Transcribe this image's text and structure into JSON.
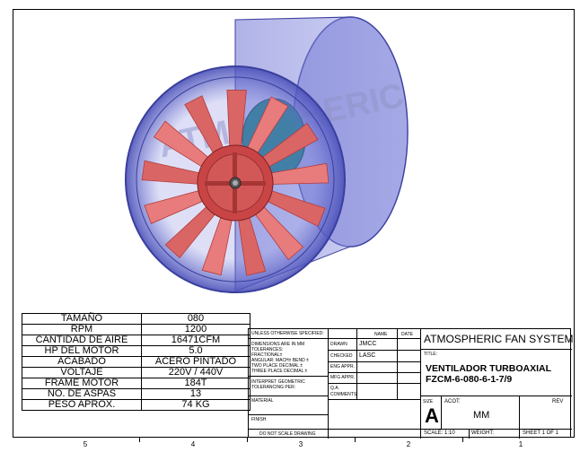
{
  "watermark": "ATMOSPHERIC",
  "specs": [
    {
      "label": "TAMAÑO",
      "value": "080"
    },
    {
      "label": "RPM",
      "value": "1200"
    },
    {
      "label": "CANTIDAD DE AIRE",
      "value": "16471CFM"
    },
    {
      "label": "HP DEL MOTOR",
      "value": "5.0"
    },
    {
      "label": "ACABADO",
      "value": "ACERO PINTADO"
    },
    {
      "label": "VOLTAJE",
      "value": "220V / 440V"
    },
    {
      "label": "FRAME MOTOR",
      "value": "184T"
    },
    {
      "label": "NO. DE ASPAS",
      "value": "13"
    },
    {
      "label": "PESO APROX.",
      "value": "74 KG"
    }
  ],
  "title_block": {
    "unless": "UNLESS OTHERWISE SPECIFIED:",
    "dims": "DIMENSIONS ARE IN MM",
    "tolerances": "TOLERANCES:",
    "fractional": "FRACTIONAL±",
    "angular": "ANGULAR: MACH±    BEND ±",
    "two_place": "TWO PLACE DECIMAL   ±",
    "three_place": "THREE PLACE DECIMAL  ±",
    "interpret": "INTERPRET GEOMETRIC",
    "tolerancing": "TOLERANCING PER:",
    "material": "MATERIAL",
    "finish": "FINISH",
    "no_scale": "DO NOT SCALE DRAWING",
    "col_name": "NAME",
    "col_date": "DATE",
    "drawn": "DRAWN",
    "drawn_name": "JMCC",
    "checked": "CHECKED",
    "checked_name": "LASC",
    "eng_appr": "ENG APPR.",
    "mfg_appr": "MFG APPR.",
    "qa": "Q.A.",
    "comments": "COMMENTS:",
    "company": "ATMOSPHERIC FAN SYSTEM",
    "title_label": "TITLE:",
    "title_line1": "VENTILADOR TURBOAXIAL",
    "title_line2": "FZCM-6-080-6-1-7/9",
    "size_label": "SIZE",
    "size_value": "A",
    "acot_label": "ACOT:",
    "units": "MM",
    "rev_label": "REV",
    "scale": "SCALE: 1:10",
    "weight": "WEIGHT:",
    "sheet": "SHEET 1 OF 1"
  },
  "zones": [
    "5",
    "4",
    "3",
    "2",
    "1"
  ],
  "colors": {
    "housing": "#5c63c9",
    "housing_dark": "#3a3f9e",
    "blade": "#e87b7b",
    "blade_dark": "#b23c3c",
    "hub": "#c94545",
    "motor": "#2f7f95"
  }
}
